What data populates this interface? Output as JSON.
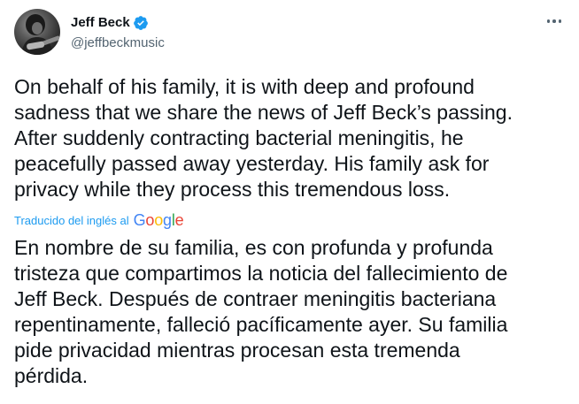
{
  "author": {
    "display_name": "Jeff Beck",
    "handle": "@jeffbeckmusic",
    "verified": true
  },
  "tweet": {
    "original_text": "On behalf of his family, it is with deep and profound\nsadness that we share the news of Jeff Beck’s passing.\nAfter suddenly contracting bacterial meningitis, he\npeacefully passed away yesterday. His family ask for\nprivacy while they process this tremendous loss.",
    "translation_label": "Traducido del inglés al",
    "translation_provider": "Google",
    "translated_text": "En nombre de su familia, es con profunda y profunda\ntristeza que compartimos la noticia del fallecimiento de\nJeff Beck. Después de contraer meningitis bacteriana\nrepentinamente, falleció pacíficamente ayer. Su familia\npide privacidad mientras procesan esta tremenda\npérdida."
  },
  "icons": {
    "verified": "verified-badge-icon",
    "more": "more-options-icon"
  },
  "colors": {
    "accent": "#1d9bf0",
    "text_primary": "#0f1419",
    "text_secondary": "#536471"
  }
}
